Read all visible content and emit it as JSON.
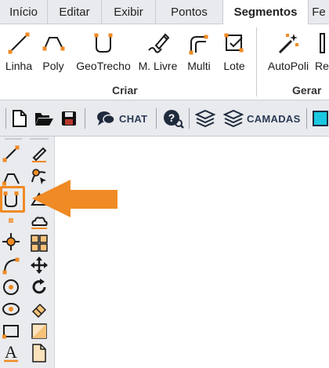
{
  "tabs": [
    {
      "label": "Início"
    },
    {
      "label": "Editar"
    },
    {
      "label": "Exibir"
    },
    {
      "label": "Pontos"
    },
    {
      "label": "Segmentos",
      "active": true
    },
    {
      "label": "Fe"
    }
  ],
  "ribbon": {
    "buttons": [
      {
        "label": "Linha",
        "icon": "line-icon"
      },
      {
        "label": "Poly",
        "icon": "polyline-icon"
      },
      {
        "label": "GeoTrecho",
        "icon": "geotrecho-icon"
      },
      {
        "label": "M. Livre",
        "icon": "freehand-pencil-icon"
      },
      {
        "label": "Multi",
        "icon": "multi-icon"
      },
      {
        "label": "Lote",
        "icon": "batch-icon"
      },
      {
        "label": "AutoPoli",
        "icon": "auto-poly-wand-icon"
      },
      {
        "label": "Re",
        "icon": "re-icon"
      }
    ],
    "groups": {
      "criar": "Criar",
      "gerar": "Gerar"
    }
  },
  "toolbar": {
    "chat_label": "CHAT",
    "camadas_label": "CAMADAS"
  },
  "colors": {
    "accent_orange": "#f08a24",
    "icon_dark": "#1f2a3d",
    "cyan_swatch": "#19c8e0",
    "toolbar_bg": "#e8eaee"
  }
}
